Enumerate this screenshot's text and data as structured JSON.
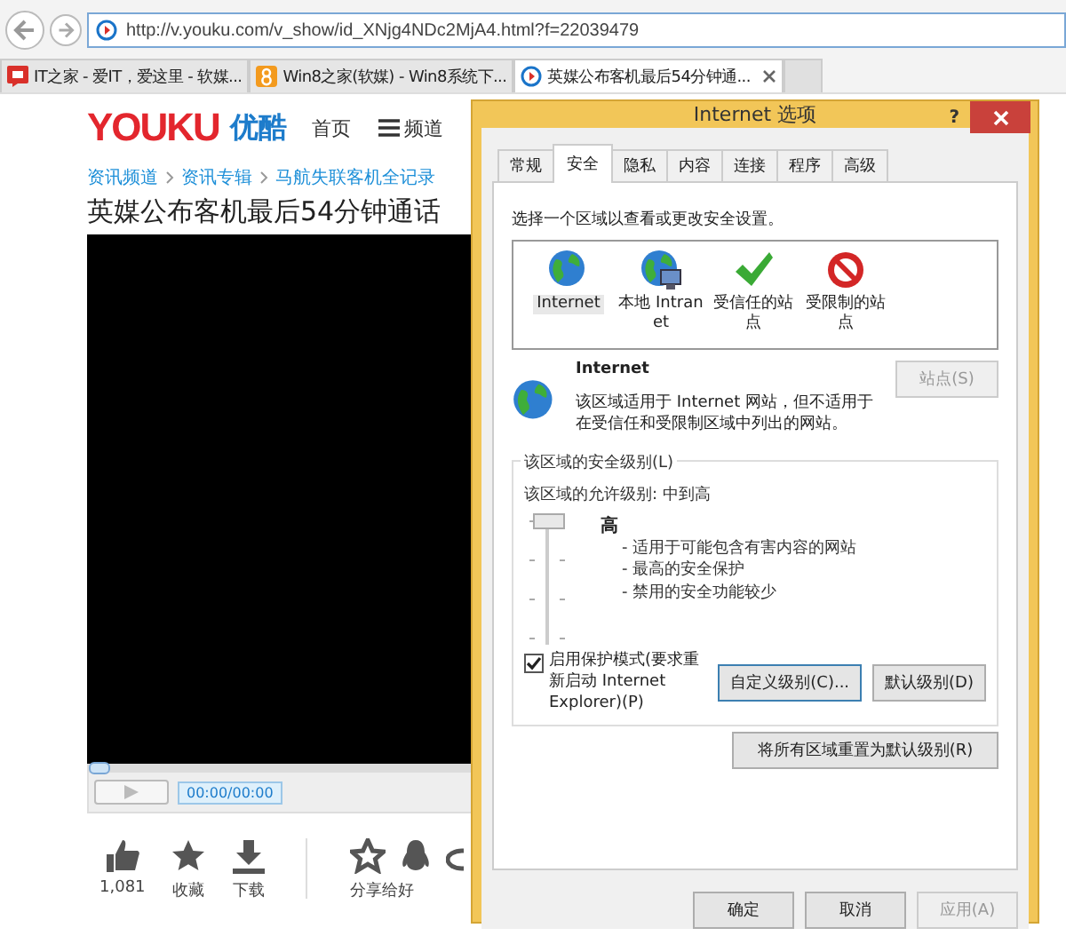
{
  "browser": {
    "address": "http://v.youku.com/v_show/id_XNjg4NDc2MjA4.html?f=22039479",
    "tabs": [
      {
        "title": "IT之家 - 爱IT，爱这里 - 软媒...",
        "kind": "red",
        "selected": false
      },
      {
        "title": "Win8之家(软媒) - Win8系统下...",
        "kind": "orange",
        "selected": false
      },
      {
        "title": "英媒公布客机最后54分钟通...",
        "kind": "play",
        "selected": true
      }
    ]
  },
  "page": {
    "logo": "YOUKU",
    "logo_cn": "优酷",
    "nav": [
      "首页",
      "频道"
    ],
    "breadcrumbs": [
      "资讯频道",
      "资讯专辑",
      "马航失联客机全记录"
    ],
    "title": "英媒公布客机最后54分钟通话",
    "player": {
      "time": "00:00/00:00",
      "level": 0
    },
    "actions": [
      {
        "label": "1,081",
        "kind": "like"
      },
      {
        "label": "收藏",
        "kind": "star"
      },
      {
        "label": "下载",
        "kind": "download"
      }
    ],
    "share_label": "分享给好"
  },
  "dialog": {
    "title": "Internet 选项",
    "help": "?",
    "tabs": [
      {
        "label": "常规",
        "selected": false
      },
      {
        "label": "安全",
        "selected": true
      },
      {
        "label": "隐私",
        "selected": false
      },
      {
        "label": "内容",
        "selected": false
      },
      {
        "label": "连接",
        "selected": false
      },
      {
        "label": "程序",
        "selected": false
      },
      {
        "label": "高级",
        "selected": false
      }
    ],
    "prompt": "选择一个区域以查看或更改安全设置。",
    "zones": [
      {
        "label": "Internet",
        "kind": "internet",
        "selected": true
      },
      {
        "label": "本地 Intranet",
        "kind": "intranet",
        "selected": false
      },
      {
        "label": "受信任的站点",
        "kind": "trusted",
        "selected": false
      },
      {
        "label": "受限制的站点",
        "kind": "restricted",
        "selected": false
      }
    ],
    "zone_name": "Internet",
    "zone_description": "该区域适用于 Internet 网站，但不适用于在受信任和受限制区域中列出的网站。",
    "sites_button": {
      "label": "站点(S)",
      "disabled": true
    },
    "security": {
      "group_label": "该区域的安全级别(L)",
      "allowed": "该区域的允许级别: 中到高",
      "level": 1,
      "level_name": "高",
      "bullets": [
        "- 适用于可能包含有害内容的网站",
        "- 最高的安全保护",
        "- 禁用的安全功能较少"
      ],
      "protected_mode": {
        "label": "启用保护模式(要求重新启动 Internet Explorer)(P)",
        "checked": true
      },
      "buttons": [
        "自定义级别(C)...",
        "默认级别(D)"
      ]
    },
    "reset_button": "将所有区域重置为默认级别(R)",
    "footer": [
      {
        "label": "确定",
        "disabled": false
      },
      {
        "label": "取消",
        "disabled": false
      },
      {
        "label": "应用(A)",
        "disabled": true
      }
    ]
  }
}
